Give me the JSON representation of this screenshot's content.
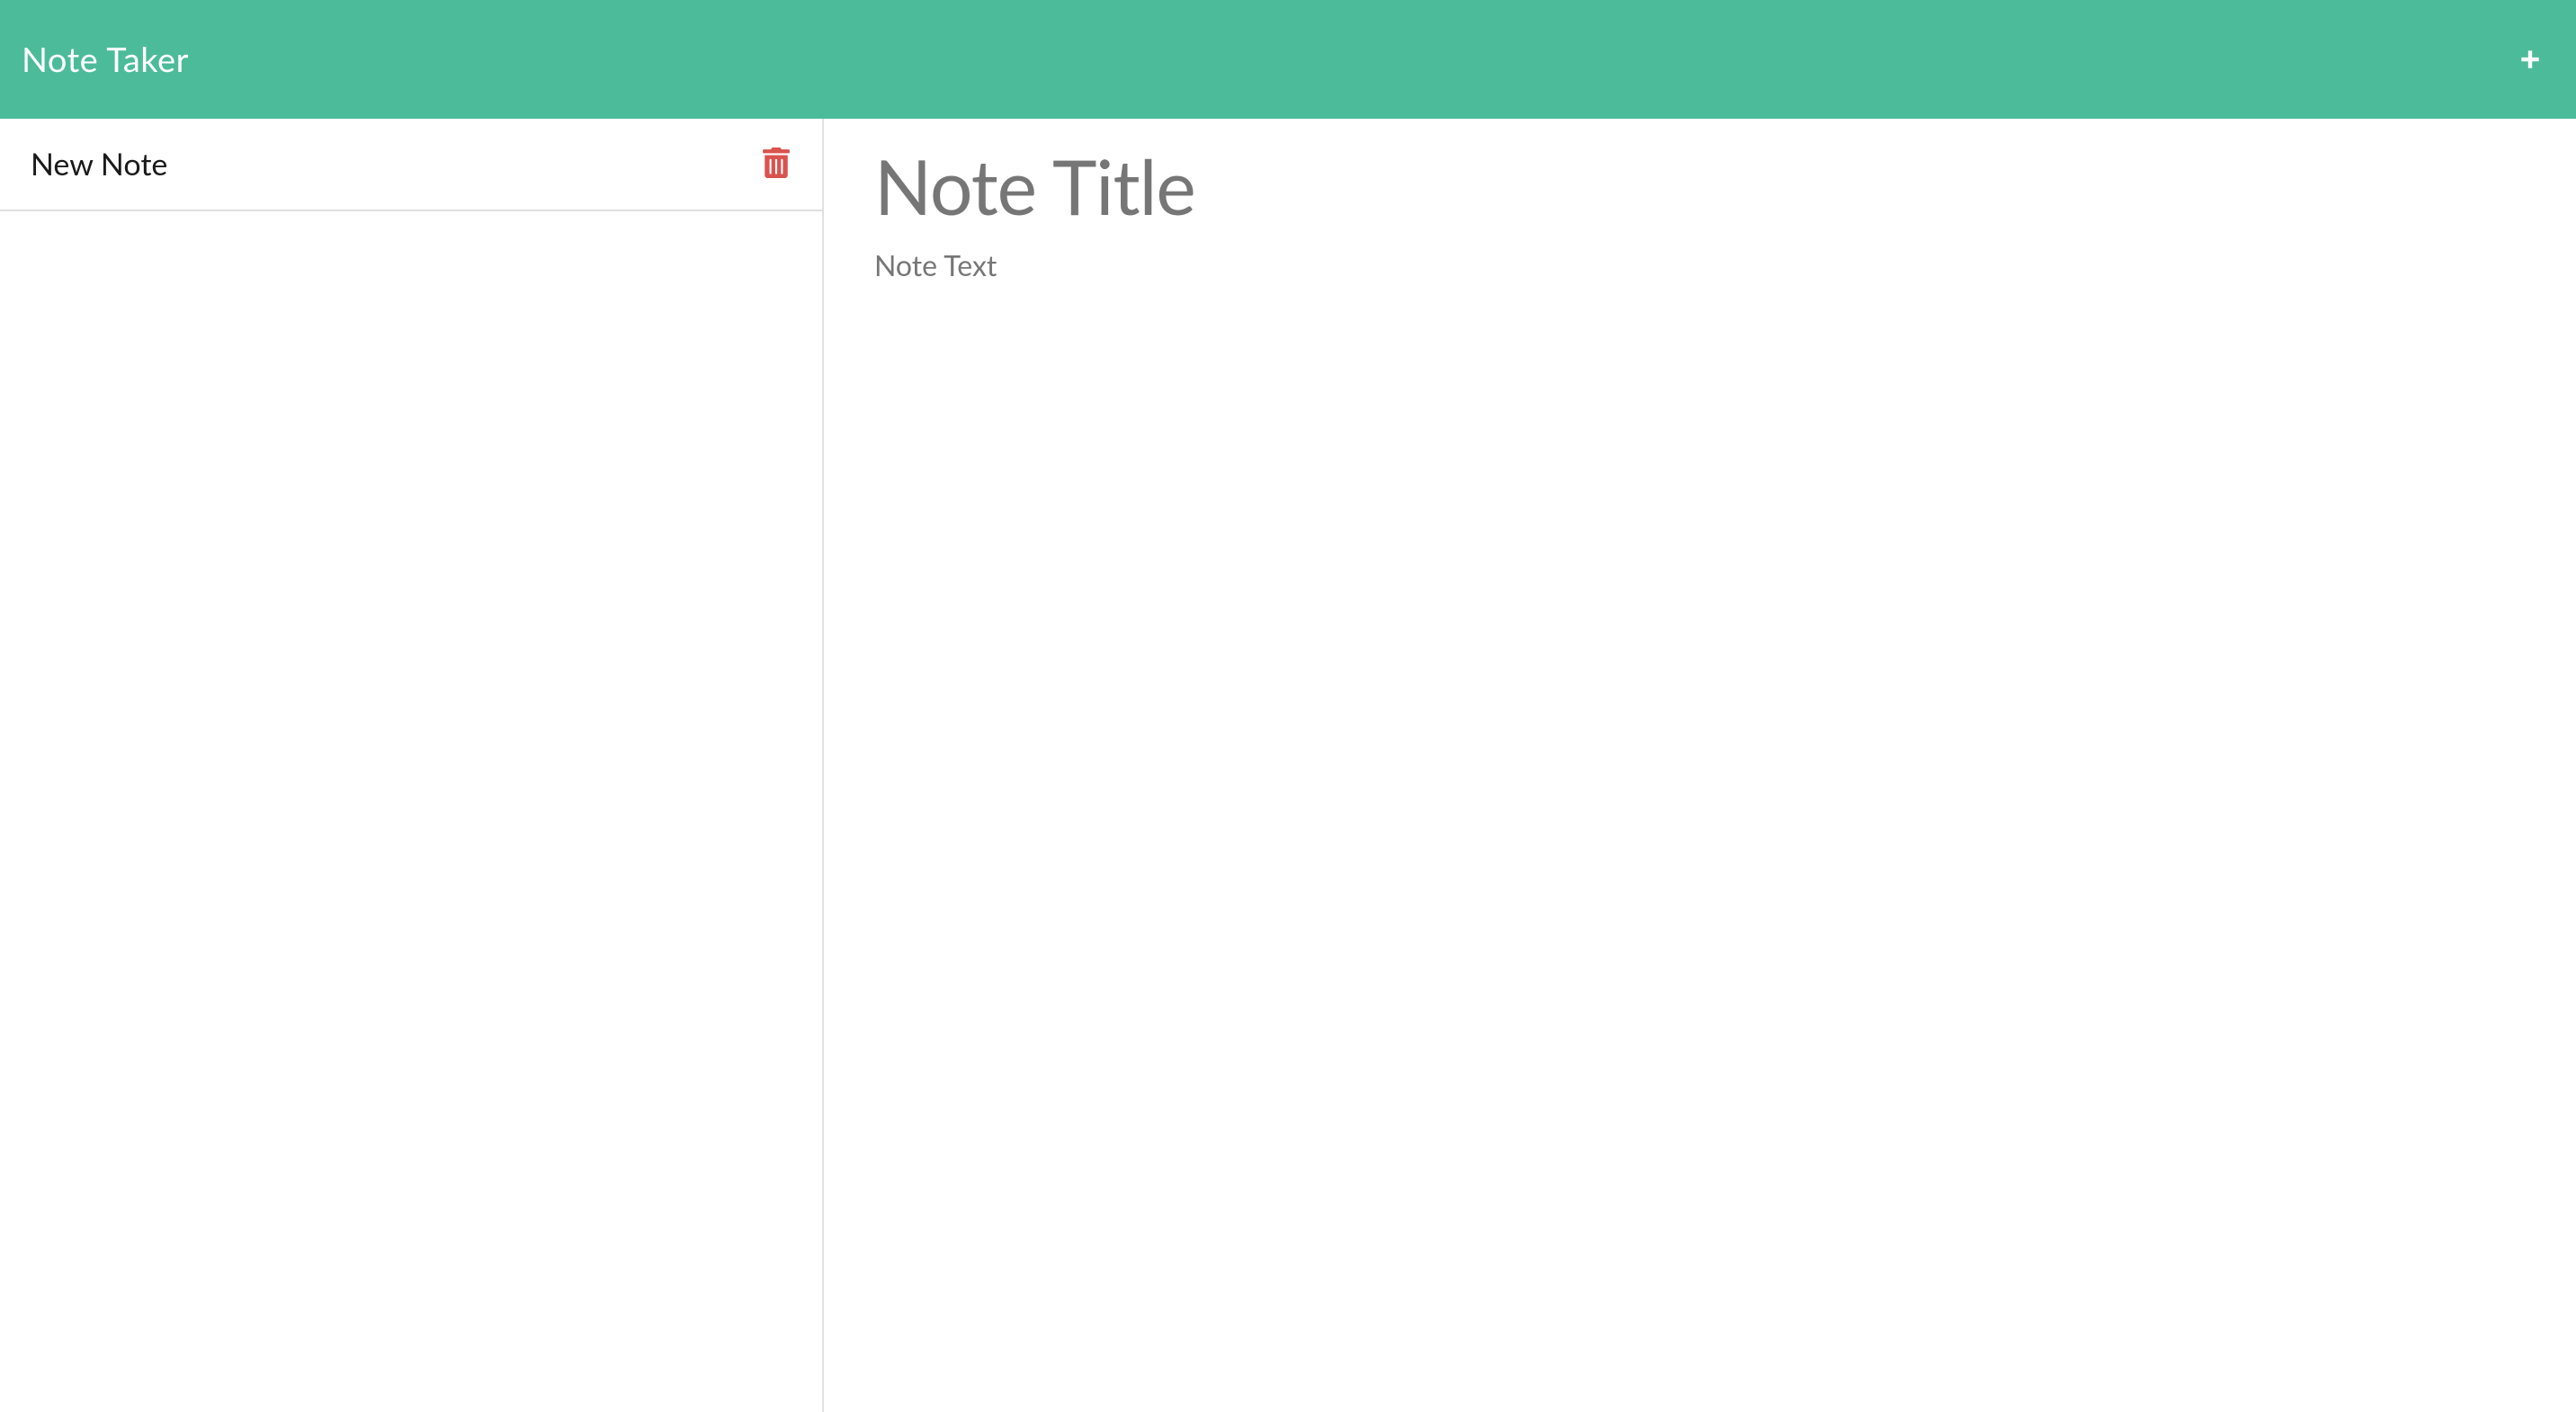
{
  "header": {
    "title": "Note Taker",
    "add_icon": "plus-icon"
  },
  "sidebar": {
    "notes": [
      {
        "title": "New Note",
        "delete_icon": "trash-icon"
      }
    ]
  },
  "editor": {
    "title_value": "",
    "title_placeholder": "Note Title",
    "text_value": "",
    "text_placeholder": "Note Text"
  },
  "colors": {
    "primary": "#4cbb99",
    "danger": "#d9534f",
    "text": "#1a1a1a",
    "placeholder": "#767676",
    "border": "#e0e0e0"
  }
}
